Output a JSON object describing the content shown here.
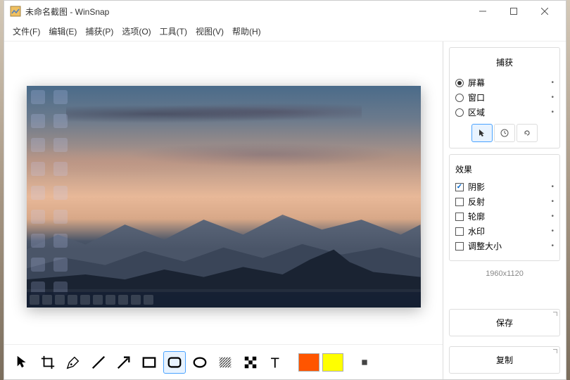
{
  "window": {
    "title": "未命名截图 - WinSnap"
  },
  "menu": {
    "file": "文件(F)",
    "edit": "编辑(E)",
    "capture": "捕获(P)",
    "options": "选项(O)",
    "tools": "工具(T)",
    "view": "视图(V)",
    "help": "帮助(H)"
  },
  "sidebar": {
    "capture": {
      "title": "捕获",
      "screen": "屏幕",
      "window": "窗口",
      "region": "区域"
    },
    "effects": {
      "title": "效果",
      "shadow": "阴影",
      "reflection": "反射",
      "outline": "轮廓",
      "watermark": "水印",
      "resize": "调整大小"
    },
    "dimensions": "1960x1120",
    "save": "保存",
    "copy": "复制"
  },
  "colors": {
    "orange": "#ff5500",
    "yellow": "#ffff00"
  }
}
